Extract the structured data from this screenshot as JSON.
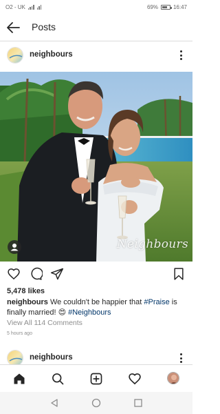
{
  "status_bar": {
    "carrier": "O2 - UK",
    "battery": "69%",
    "battery_level": 0.69,
    "time": "16:47"
  },
  "header": {
    "title": "Posts"
  },
  "post": {
    "username": "neighbours",
    "watermark": "Neighbours",
    "likes": "5,478 likes",
    "caption": {
      "username": "neighbours",
      "text_before": "We couldn't be happier that",
      "hashtag_1": "#Praise",
      "text_middle": "is finally married!",
      "emoji": "😍",
      "hashtag_2": "#Neighbours"
    },
    "view_comments": "View All 114 Comments",
    "time_ago": "5 hours ago"
  },
  "next_post": {
    "username": "neighbours"
  },
  "colors": {
    "text": "#262626",
    "hashtag": "#003569",
    "secondary": "#8e8e8e",
    "divider": "#dbdbdb"
  },
  "icons": {
    "header": [
      "back-arrow-icon"
    ],
    "actions": [
      "heart-icon",
      "comment-icon",
      "share-icon",
      "bookmark-icon"
    ],
    "bottom_nav": [
      "home-icon",
      "search-icon",
      "new-post-icon",
      "activity-heart-icon",
      "profile-avatar"
    ],
    "system_nav": [
      "back-triangle-icon",
      "home-circle-icon",
      "recents-square-icon"
    ]
  }
}
